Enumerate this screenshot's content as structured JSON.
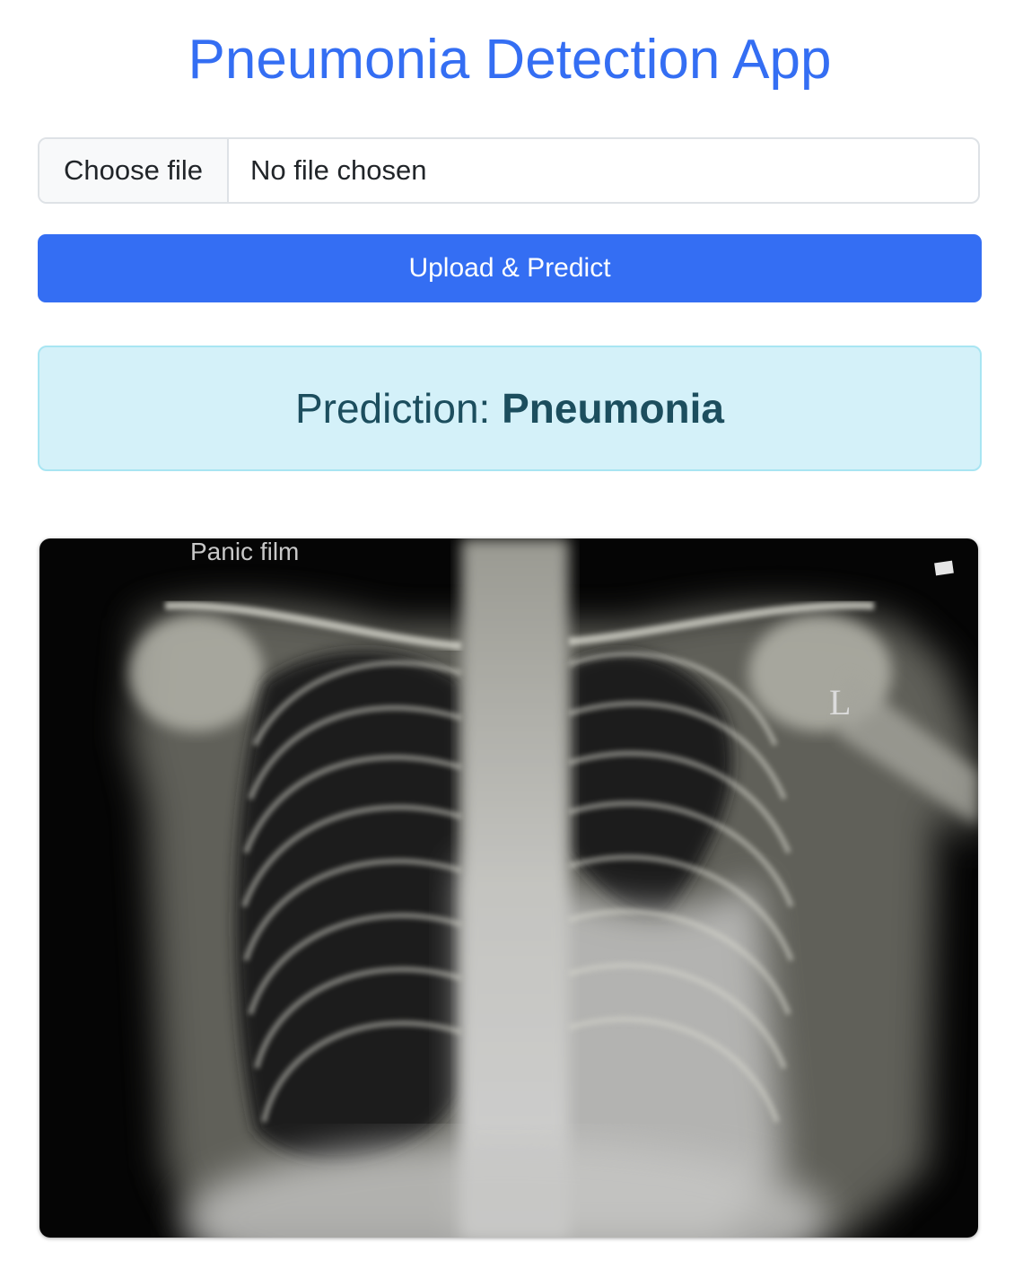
{
  "app": {
    "title": "Pneumonia Detection App"
  },
  "file_input": {
    "button_label": "Choose file",
    "status": "No file chosen"
  },
  "actions": {
    "predict_label": "Upload & Predict"
  },
  "prediction": {
    "label": "Prediction:",
    "value": "Pneumonia"
  },
  "xray": {
    "caption": "Panic film",
    "side_marker": "L"
  },
  "colors": {
    "accent": "#346ef3",
    "title": "#346ef3",
    "alert_bg": "#d4f1f9",
    "alert_border": "#a8e5f2",
    "alert_text": "#1c4e5e"
  }
}
